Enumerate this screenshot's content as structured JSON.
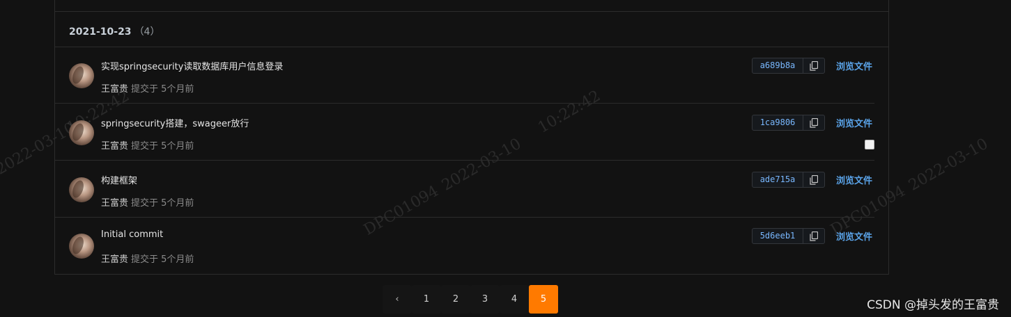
{
  "watermark": {
    "texts": [
      "2022-03-10",
      "10:22:42",
      "2022-03-10",
      "10:22:42",
      "DPC01094",
      "2022-03-10",
      "DPC01094",
      "2022-03-10",
      "10:22:42"
    ]
  },
  "group": {
    "date": "2021-10-23",
    "count": "（4）"
  },
  "commits": [
    {
      "message": "实现springsecurity读取数据库用户信息登录",
      "author": "王富贵",
      "when": "提交于 5个月前",
      "sha": "a689b8a",
      "browse": "浏览文件"
    },
    {
      "message": "springsecurity搭建，swageer放行",
      "author": "王富贵",
      "when": "提交于 5个月前",
      "sha": "1ca9806",
      "browse": "浏览文件"
    },
    {
      "message": "构建框架",
      "author": "王富贵",
      "when": "提交于 5个月前",
      "sha": "ade715a",
      "browse": "浏览文件"
    },
    {
      "message": "Initial commit",
      "author": "王富贵",
      "when": "提交于 5个月前",
      "sha": "5d6eeb1",
      "browse": "浏览文件"
    }
  ],
  "pagination": {
    "prev": "‹",
    "pages": [
      "1",
      "2",
      "3",
      "4",
      "5"
    ],
    "active": "5"
  },
  "footer": {
    "csdn_credit": "CSDN @掉头发的王富贵"
  },
  "colors": {
    "accent": "#ff7a00",
    "link": "#5aa3e8",
    "sha": "#79b8ff",
    "background": "#121212"
  }
}
